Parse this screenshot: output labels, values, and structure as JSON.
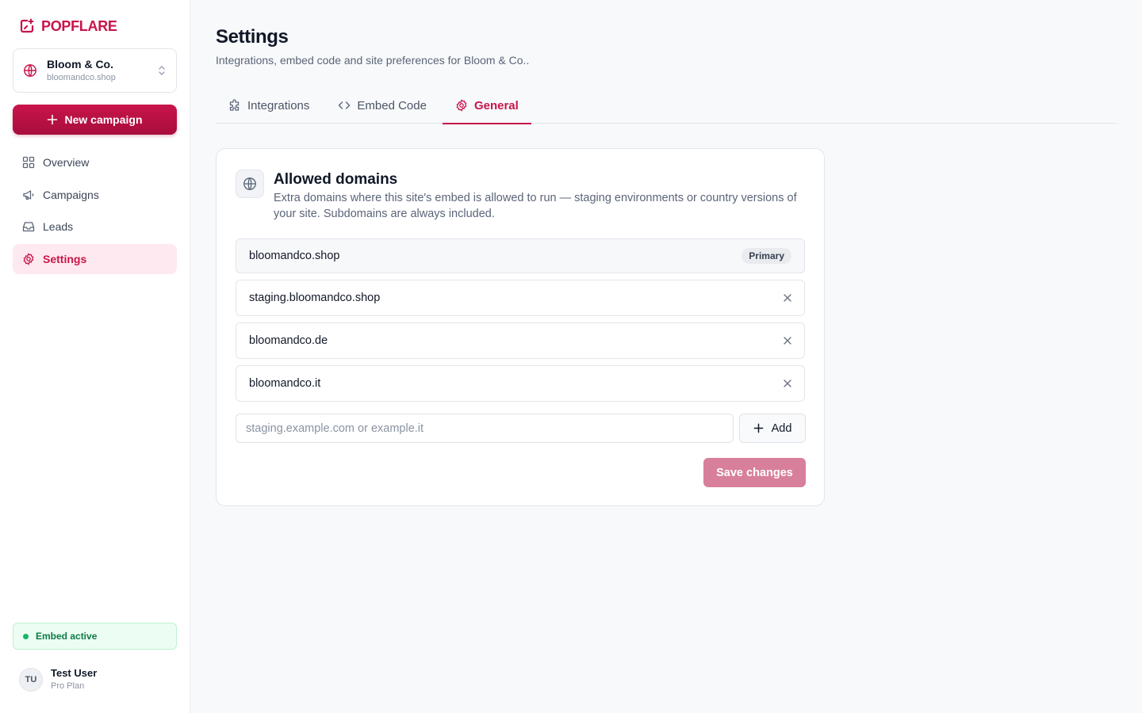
{
  "brand": {
    "name": "POPFLARE",
    "accent": "#c8154a",
    "icon": "popup-spark-icon"
  },
  "site": {
    "name": "Bloom & Co.",
    "domain": "bloomandco.shop"
  },
  "actions": {
    "new_campaign": "New campaign"
  },
  "nav": [
    {
      "label": "Overview",
      "icon": "grid-icon",
      "active": false
    },
    {
      "label": "Campaigns",
      "icon": "megaphone-icon",
      "active": false
    },
    {
      "label": "Leads",
      "icon": "inbox-icon",
      "active": false
    },
    {
      "label": "Settings",
      "icon": "gear-icon",
      "active": true
    }
  ],
  "embed_status": {
    "label": "Embed active",
    "color": "#12b76a"
  },
  "user": {
    "initials": "TU",
    "name": "Test User",
    "plan": "Pro Plan"
  },
  "page": {
    "title": "Settings",
    "subtitle": "Integrations, embed code and site preferences for Bloom & Co.."
  },
  "tabs": [
    {
      "label": "Integrations",
      "icon": "puzzle-icon",
      "active": false
    },
    {
      "label": "Embed Code",
      "icon": "code-icon",
      "active": false
    },
    {
      "label": "General",
      "icon": "gear-icon",
      "active": true
    }
  ],
  "domains_card": {
    "title": "Allowed domains",
    "description": "Extra domains where this site's embed is allowed to run — staging environments or country versions of your site. Subdomains are always included.",
    "primary": {
      "domain": "bloomandco.shop",
      "badge": "Primary"
    },
    "extra": [
      "staging.bloomandco.shop",
      "bloomandco.de",
      "bloomandco.it"
    ],
    "input_placeholder": "staging.example.com or example.it",
    "add_label": "Add",
    "save_label": "Save changes"
  }
}
